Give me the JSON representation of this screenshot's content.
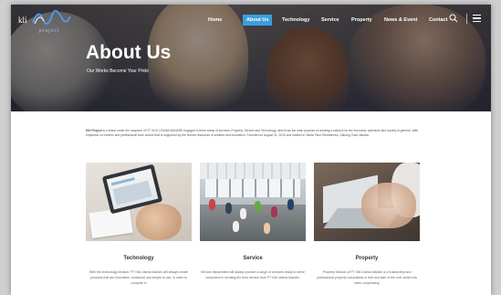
{
  "brand": {
    "name": "kli",
    "sub": "project"
  },
  "nav": {
    "items": [
      {
        "label": "Home",
        "active": false
      },
      {
        "label": "About Us",
        "active": true
      },
      {
        "label": "Technology",
        "active": false
      },
      {
        "label": "Service",
        "active": false
      },
      {
        "label": "Property",
        "active": false
      },
      {
        "label": "News & Event",
        "active": false
      },
      {
        "label": "Contact",
        "active": false
      }
    ],
    "active_color": "#3a9fdc"
  },
  "icons": {
    "search": "search-icon",
    "menu": "hamburger-menu-icon"
  },
  "hero": {
    "title": "About Us",
    "subtitle": "Our Works Become Your Pride"
  },
  "intro": {
    "lead": "KIN Project",
    "text": " is a brand under the auspices of PT. KLIK UTAMA MANDIRI engaged in three areas of services; Property, Service and Technology, which has the main purpose of creating a solution for the economic operators and society in general. With emphasis on modern and professional work culture that is supported by the human resources of creative and innovation. Founded on August 31, 2015 and located in Santa Fleur Residences, Cakung, East Jakarta."
  },
  "cards": [
    {
      "title": "Technology",
      "desc": "With the technology division, PT Klik Utama Mandiri will always create products that are innovative, functional and simple to use, in order to compete in"
    },
    {
      "title": "Service",
      "desc": "Service department will always provide a range of services ready to serve customers in sending the best service from PT Klik Utama Mandiri."
    },
    {
      "title": "Property",
      "desc": "Property division of PT Klik Utama Mandiri is a trustworthy and professional property consultants in rent and sale of the unit, which has been cooperating"
    }
  ]
}
